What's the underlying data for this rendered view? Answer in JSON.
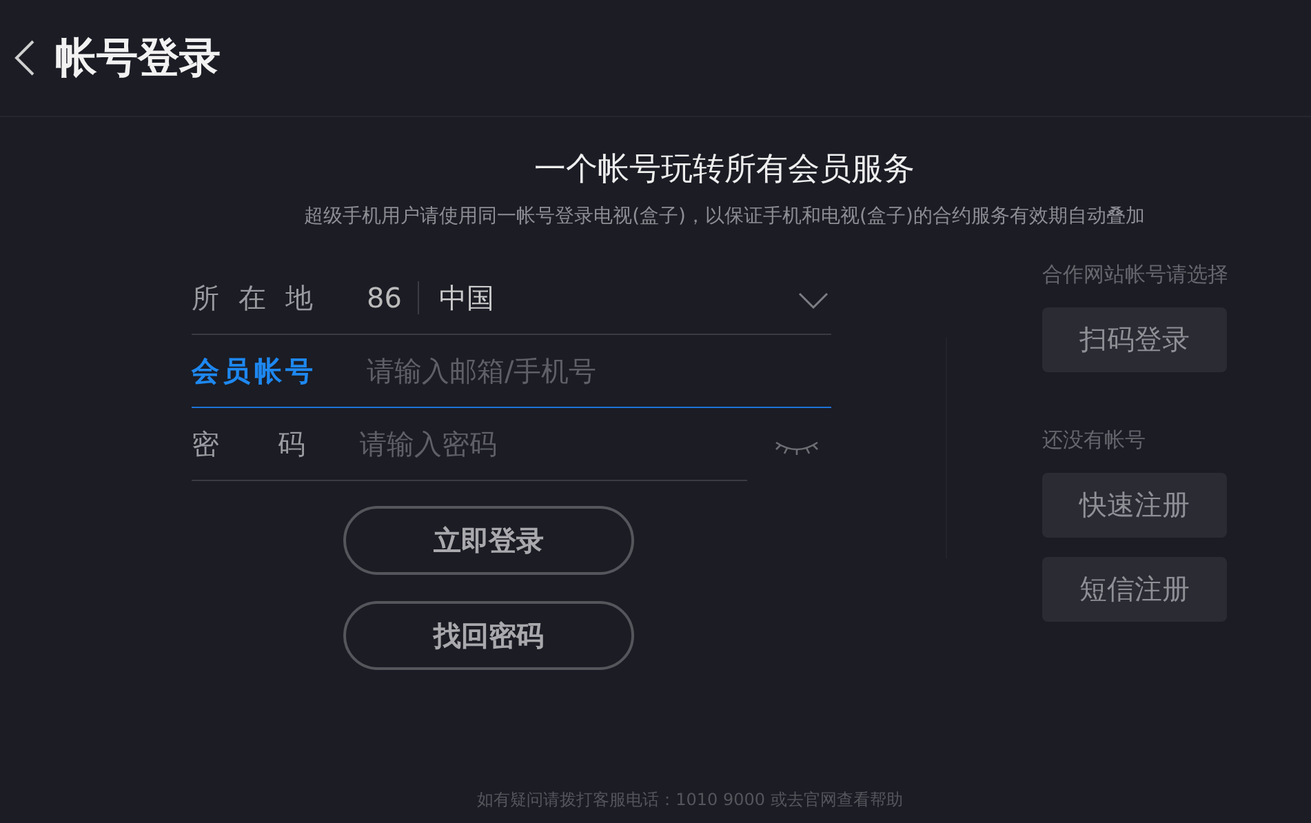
{
  "header": {
    "title": "帐号登录"
  },
  "headline": "一个帐号玩转所有会员服务",
  "subtitle": "超级手机用户请使用同一帐号登录电视(盒子)，以保证手机和电视(盒子)的合约服务有效期自动叠加",
  "fields": [
    {
      "kind": "location",
      "label": "所在地",
      "code": "86",
      "value": "中国",
      "focused": false
    },
    {
      "kind": "text",
      "label": "会员帐号",
      "placeholder": "请输入邮箱/手机号",
      "focused": true
    },
    {
      "kind": "password",
      "label": "密码",
      "placeholder": "请输入密码",
      "focused": false
    }
  ],
  "buttons": [
    "立即登录",
    "找回密码"
  ],
  "side": [
    {
      "caption": "合作网站帐号请选择",
      "buttons": [
        "扫码登录"
      ]
    },
    {
      "caption": "还没有帐号",
      "buttons": [
        "快速注册",
        "短信注册"
      ]
    }
  ],
  "footer": "如有疑问请拨打客服电话：1010 9000 或去官网查看帮助"
}
